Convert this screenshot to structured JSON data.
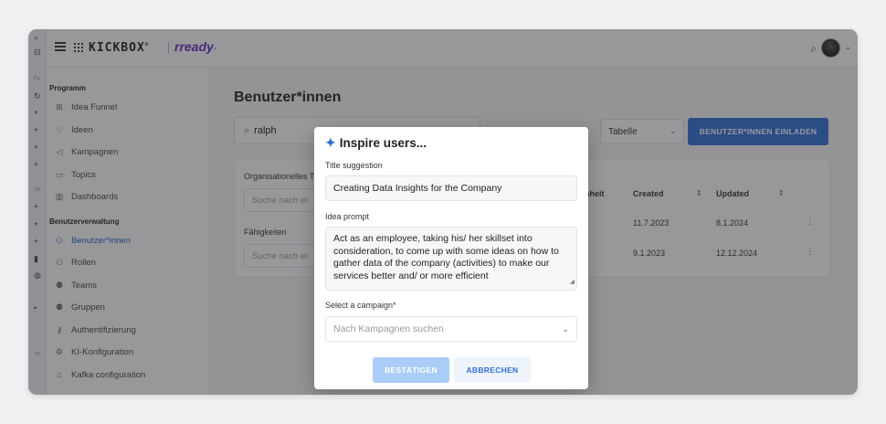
{
  "topbar": {
    "logo_primary": "KICKBOX",
    "logo_primary_mark": "®",
    "logo_secondary": "rready",
    "logo_secondary_mark": "·"
  },
  "sidebar": {
    "section_programm": "Programm",
    "programm_items": [
      {
        "label": "Idea Funnel",
        "icon": "funnel-grid-icon"
      },
      {
        "label": "Ideen",
        "icon": "lightbulb-icon"
      },
      {
        "label": "Kampagnen",
        "icon": "megaphone-icon"
      },
      {
        "label": "Topics",
        "icon": "topics-icon"
      },
      {
        "label": "Dashboards",
        "icon": "bar-chart-icon"
      }
    ],
    "section_users": "Benutzerverwaltung",
    "user_items": [
      {
        "label": "Benutzer*innen",
        "icon": "user-icon",
        "active": true
      },
      {
        "label": "Rollen",
        "icon": "roles-icon"
      },
      {
        "label": "Teams",
        "icon": "team-icon"
      },
      {
        "label": "Gruppen",
        "icon": "groups-icon"
      },
      {
        "label": "Authentifizierung",
        "icon": "key-icon"
      },
      {
        "label": "KI-Konfiguration",
        "icon": "ai-config-icon"
      },
      {
        "label": "Kafka configuration",
        "icon": "kafka-icon"
      }
    ]
  },
  "strip": {
    "label_1": "Fe",
    "label_2": "Sh",
    "label_3": "Yo"
  },
  "main": {
    "page_title": "Benutzer*innen",
    "search_value": "ralph",
    "view_select": "Tabelle",
    "invite_button": "BENUTZER*INNEN EINLADEN",
    "filters": {
      "org_label": "Organisationelles T",
      "org_placeholder": "Suche nach ei",
      "skills_label": "Fähigkeiten",
      "skills_placeholder": "Suche nach ei"
    },
    "table": {
      "col_unit": "nheit",
      "col_created": "Created",
      "col_updated": "Updated",
      "rows": [
        {
          "created": "11.7.2023",
          "updated": "8.1.2024"
        },
        {
          "created": "9.1.2023",
          "updated": "12.12.2024"
        }
      ]
    }
  },
  "modal": {
    "title": "Inspire users...",
    "title_suggestion_label": "Title suggestion",
    "title_suggestion_value": "Creating Data Insights for the Company",
    "idea_prompt_label": "Idea prompt",
    "idea_prompt_value": "Act as an employee, taking his/ her skillset into consideration, to come up with some ideas on how to gather data of the company (activities) to make our services better and/ or more efficient",
    "campaign_label": "Select a campaign*",
    "campaign_placeholder": "Nach Kampagnen suchen",
    "confirm_button": "BESTÄTIGEN",
    "cancel_button": "ABBRECHEN"
  },
  "colors": {
    "accent": "#2f6fd6",
    "brand_purple": "#6a2ab8",
    "confirm_disabled": "#a9cdf6"
  }
}
